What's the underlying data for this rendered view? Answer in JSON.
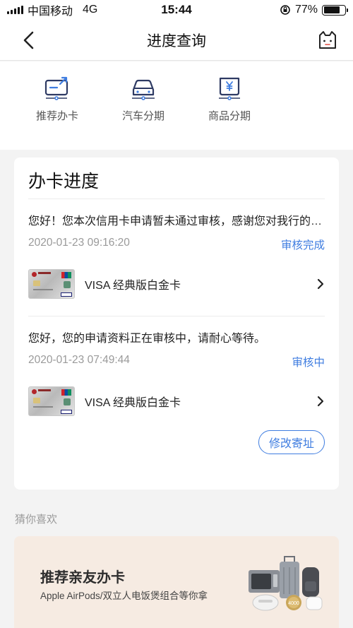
{
  "status_bar": {
    "carrier": "中国移动",
    "network": "4G",
    "time": "15:44",
    "battery": "77%",
    "battery_level": 0.77
  },
  "nav": {
    "title": "进度查询"
  },
  "quick_links": [
    {
      "label": "推荐办卡",
      "icon": "recommend-card-icon"
    },
    {
      "label": "汽车分期",
      "icon": "car-icon"
    },
    {
      "label": "商品分期",
      "icon": "shopping-yen-icon"
    }
  ],
  "progress": {
    "title": "办卡进度",
    "applications": [
      {
        "message": "您好！您本次信用卡申请暂未通过审核，感谢您对我行的关注与支持。",
        "date": "2020-01-23 09:16:20",
        "status": "审核完成",
        "card_name": "VISA 经典版白金卡"
      },
      {
        "message": "您好，您的申请资料正在审核中，请耐心等待。",
        "date": "2020-01-23 07:49:44",
        "status": "审核中",
        "card_name": "VISA 经典版白金卡"
      }
    ],
    "edit_address": "修改寄址"
  },
  "recommend": {
    "section_title": "猜你喜欢",
    "promo_title": "推荐亲友办卡",
    "promo_subtitle": "Apple AirPods/双立人电饭煲组合等你拿",
    "badge": "4000"
  },
  "colors": {
    "accent": "#3f7de0",
    "icon_navy": "#2e3a63",
    "promo_bg": "#f6ebe2"
  }
}
